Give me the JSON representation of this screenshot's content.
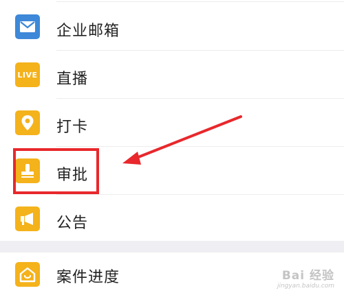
{
  "menu": {
    "items": [
      {
        "label": "企业邮箱",
        "icon": "envelope-icon",
        "color": "#3d88d8"
      },
      {
        "label": "直播",
        "icon": "live-icon",
        "color": "#f4b21b",
        "badge": "LIVE"
      },
      {
        "label": "打卡",
        "icon": "location-pin-icon",
        "color": "#f4b21b"
      },
      {
        "label": "审批",
        "icon": "stamp-icon",
        "color": "#f4b21b"
      },
      {
        "label": "公告",
        "icon": "megaphone-icon",
        "color": "#f4b21b"
      },
      {
        "label": "案件进度",
        "icon": "house-icon",
        "color": "#f4b21b"
      }
    ]
  },
  "annotation": {
    "color": "#e8282c"
  },
  "watermark": {
    "line1": "Bai 经验",
    "line2": "jingyan.baidu.com"
  }
}
